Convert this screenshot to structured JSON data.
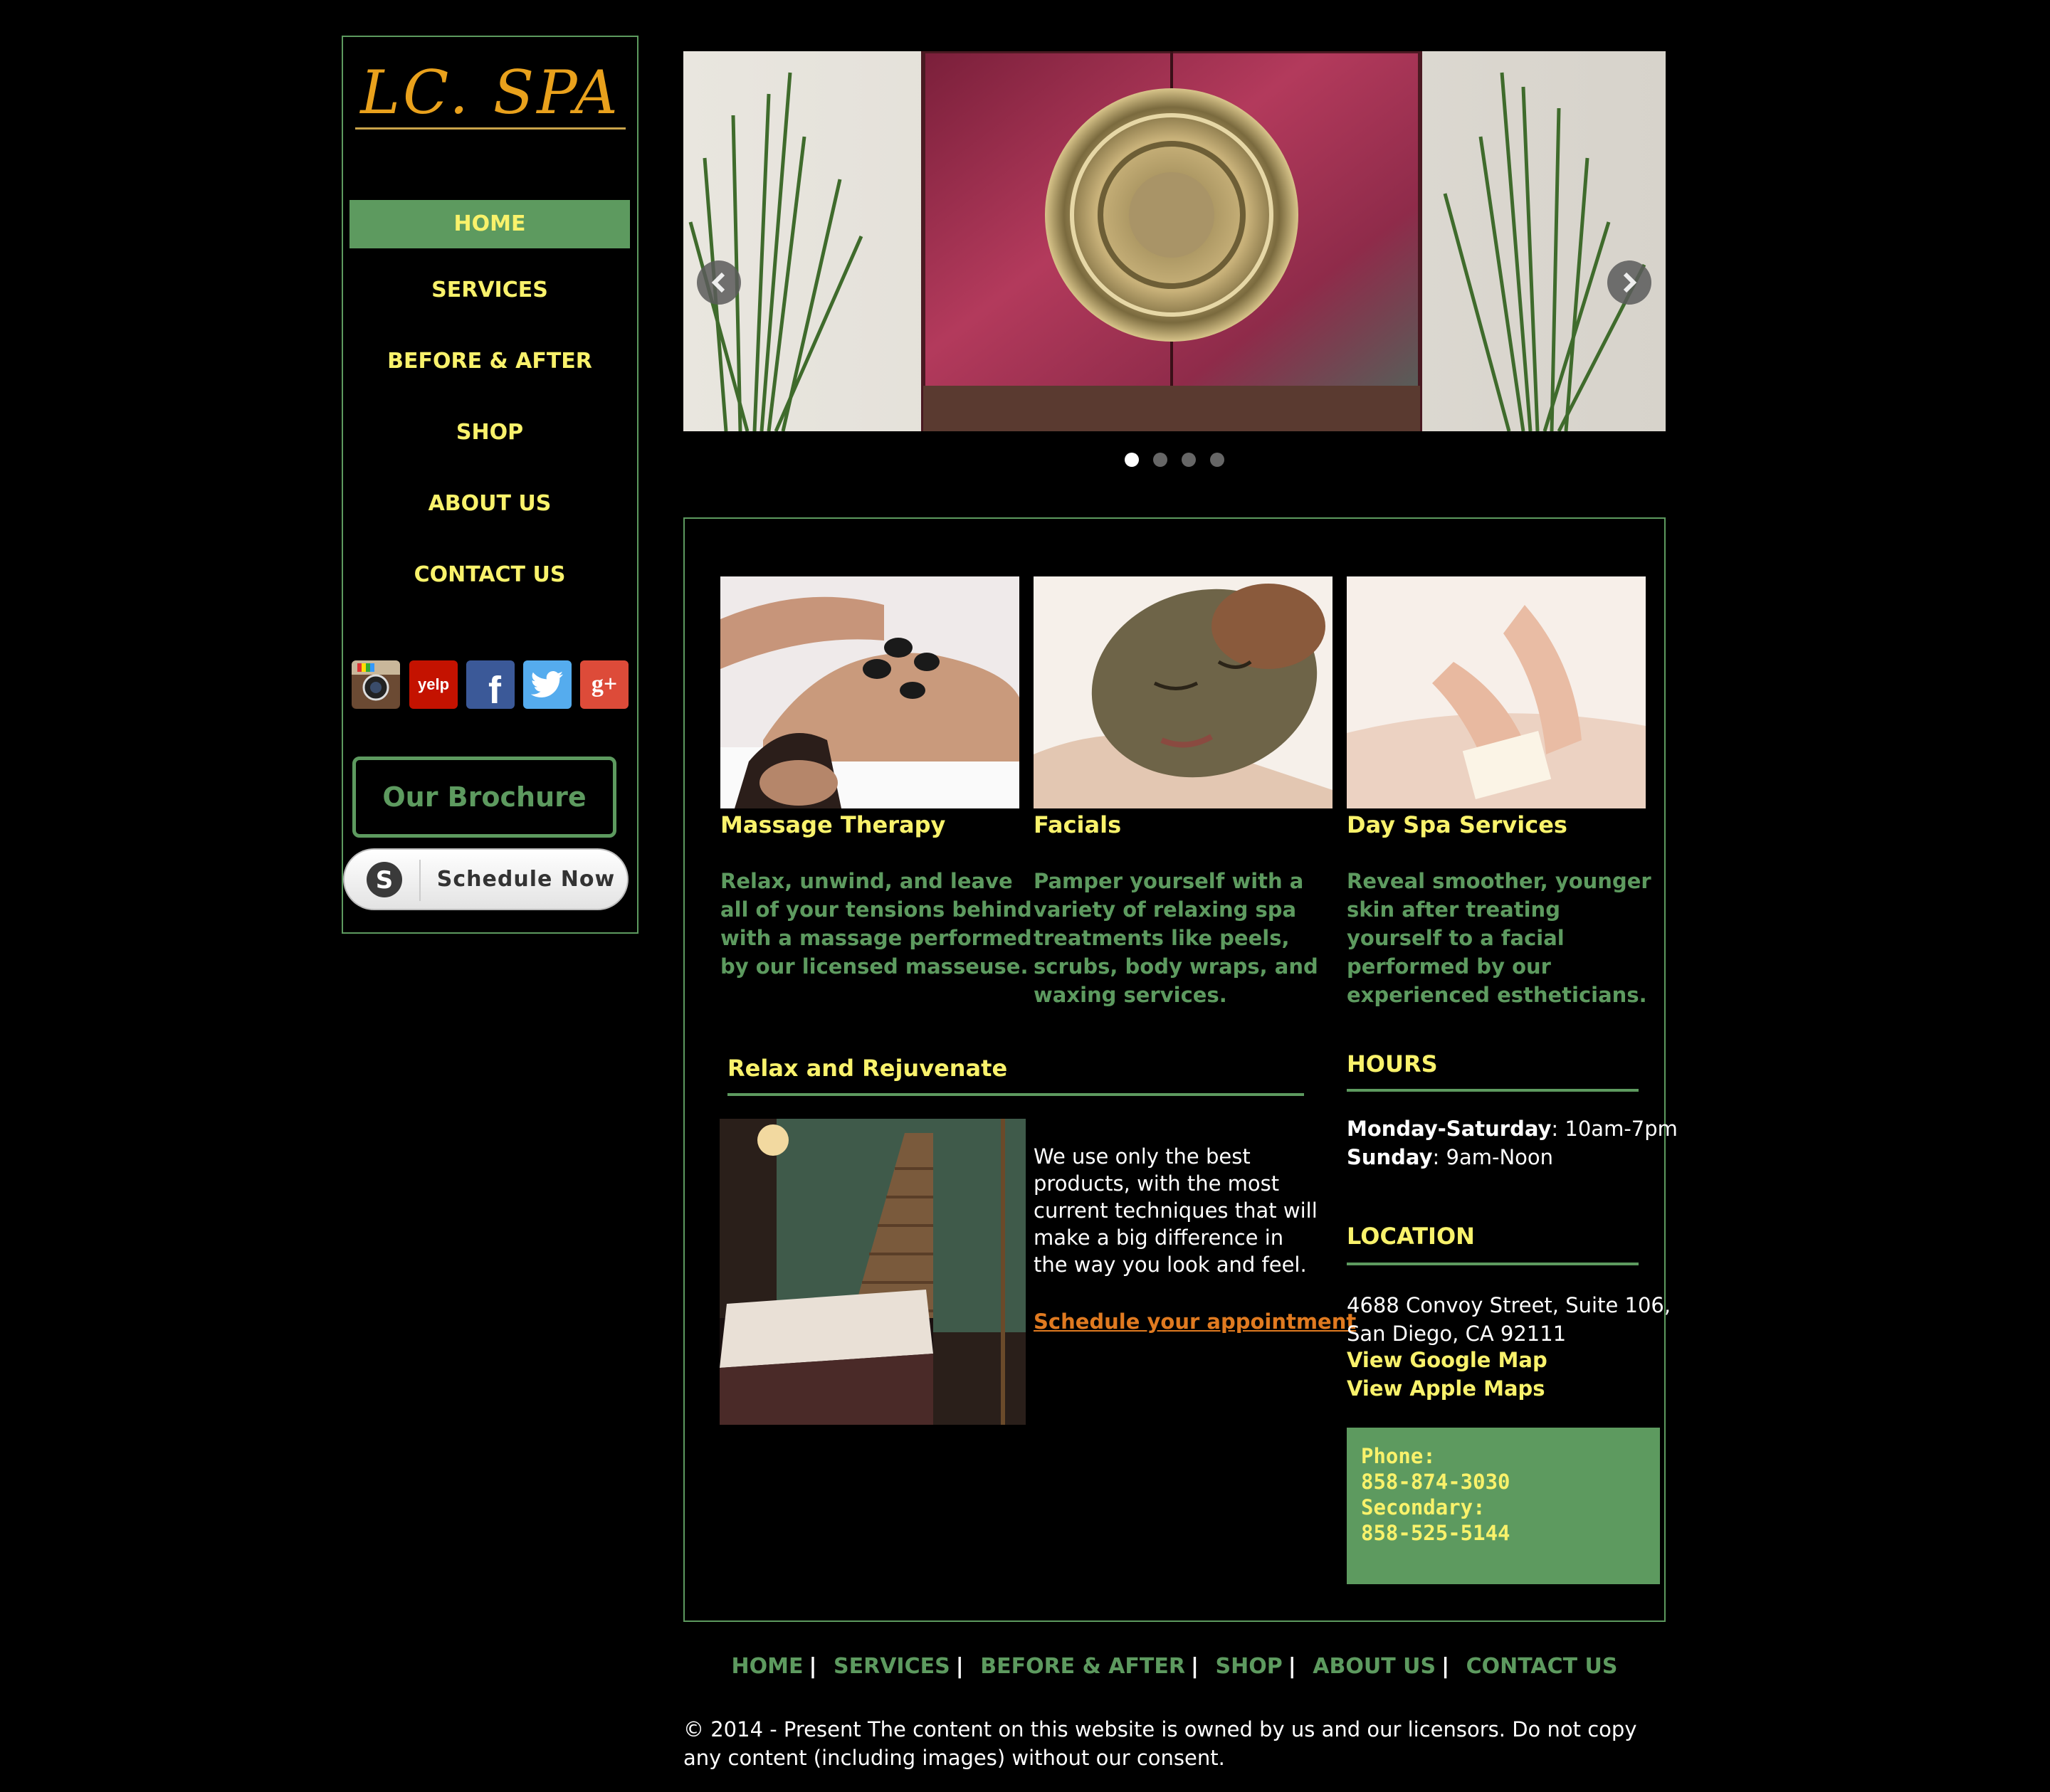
{
  "brand": {
    "logo_text": "LC. SPA"
  },
  "nav": [
    {
      "label": "HOME",
      "active": true
    },
    {
      "label": "SERVICES"
    },
    {
      "label": "BEFORE & AFTER"
    },
    {
      "label": "SHOP"
    },
    {
      "label": "ABOUT US"
    },
    {
      "label": "CONTACT US"
    }
  ],
  "social": [
    {
      "icon": "instagram-icon"
    },
    {
      "icon": "yelp-icon",
      "text": "yelp"
    },
    {
      "icon": "facebook-icon",
      "text": "f"
    },
    {
      "icon": "twitter-icon"
    },
    {
      "icon": "google-plus-icon",
      "text": "g+"
    }
  ],
  "brochure": {
    "label": "Our Brochure"
  },
  "schedule": {
    "label": "Schedule Now",
    "icon_letter": "S"
  },
  "slider": {
    "total_slides": 4,
    "current_slide": 1,
    "prev_icon": "chevron-left-icon",
    "next_icon": "chevron-right-icon"
  },
  "services": [
    {
      "title": "Massage Therapy",
      "text": "Relax, unwind, and leave all of your tensions behind with a massage performed by our licensed masseuse."
    },
    {
      "title": "Facials",
      "text": "Pamper yourself with a variety of relaxing spa treatments like peels, scrubs, body wraps, and waxing services."
    },
    {
      "title": "Day Spa Services",
      "text": "Reveal smoother, younger skin after treating yourself to a facial performed by our experienced estheticians."
    }
  ],
  "relax": {
    "title": "Relax and Rejuvenate",
    "text": "We use only  the best products, with the most current techniques that will make a big difference in the way you look and feel.",
    "link": "Schedule your appointment"
  },
  "hours": {
    "title": "HOURS",
    "line1_label": "Monday-Saturday",
    "line1_value": ": 10am-7pm",
    "line2_label": "Sunday",
    "line2_value": ": 9am-Noon"
  },
  "location": {
    "title": "LOCATION",
    "address1": "4688 Convoy Street, Suite 106,",
    "address2": "San Diego, CA 92111",
    "google_map": "View Google Map",
    "apple_map": "View Apple Maps"
  },
  "phone": {
    "label": "Phone:",
    "number": "858-874-3030",
    "secondary_label": "Secondary:",
    "secondary_number": "858-525-5144"
  },
  "footer": {
    "nav": [
      "HOME",
      "SERVICES",
      "BEFORE & AFTER",
      "SHOP",
      "ABOUT US",
      "CONTACT US"
    ],
    "copyright": "© 2014 - Present The content on this website is owned by us and our licensors. Do not copy any content (including images) without our consent."
  },
  "colors": {
    "accent_green": "#5d9a5f",
    "accent_yellow": "#f9f26b",
    "link_orange": "#e07a20",
    "logo_gold": "#e9a11c"
  }
}
